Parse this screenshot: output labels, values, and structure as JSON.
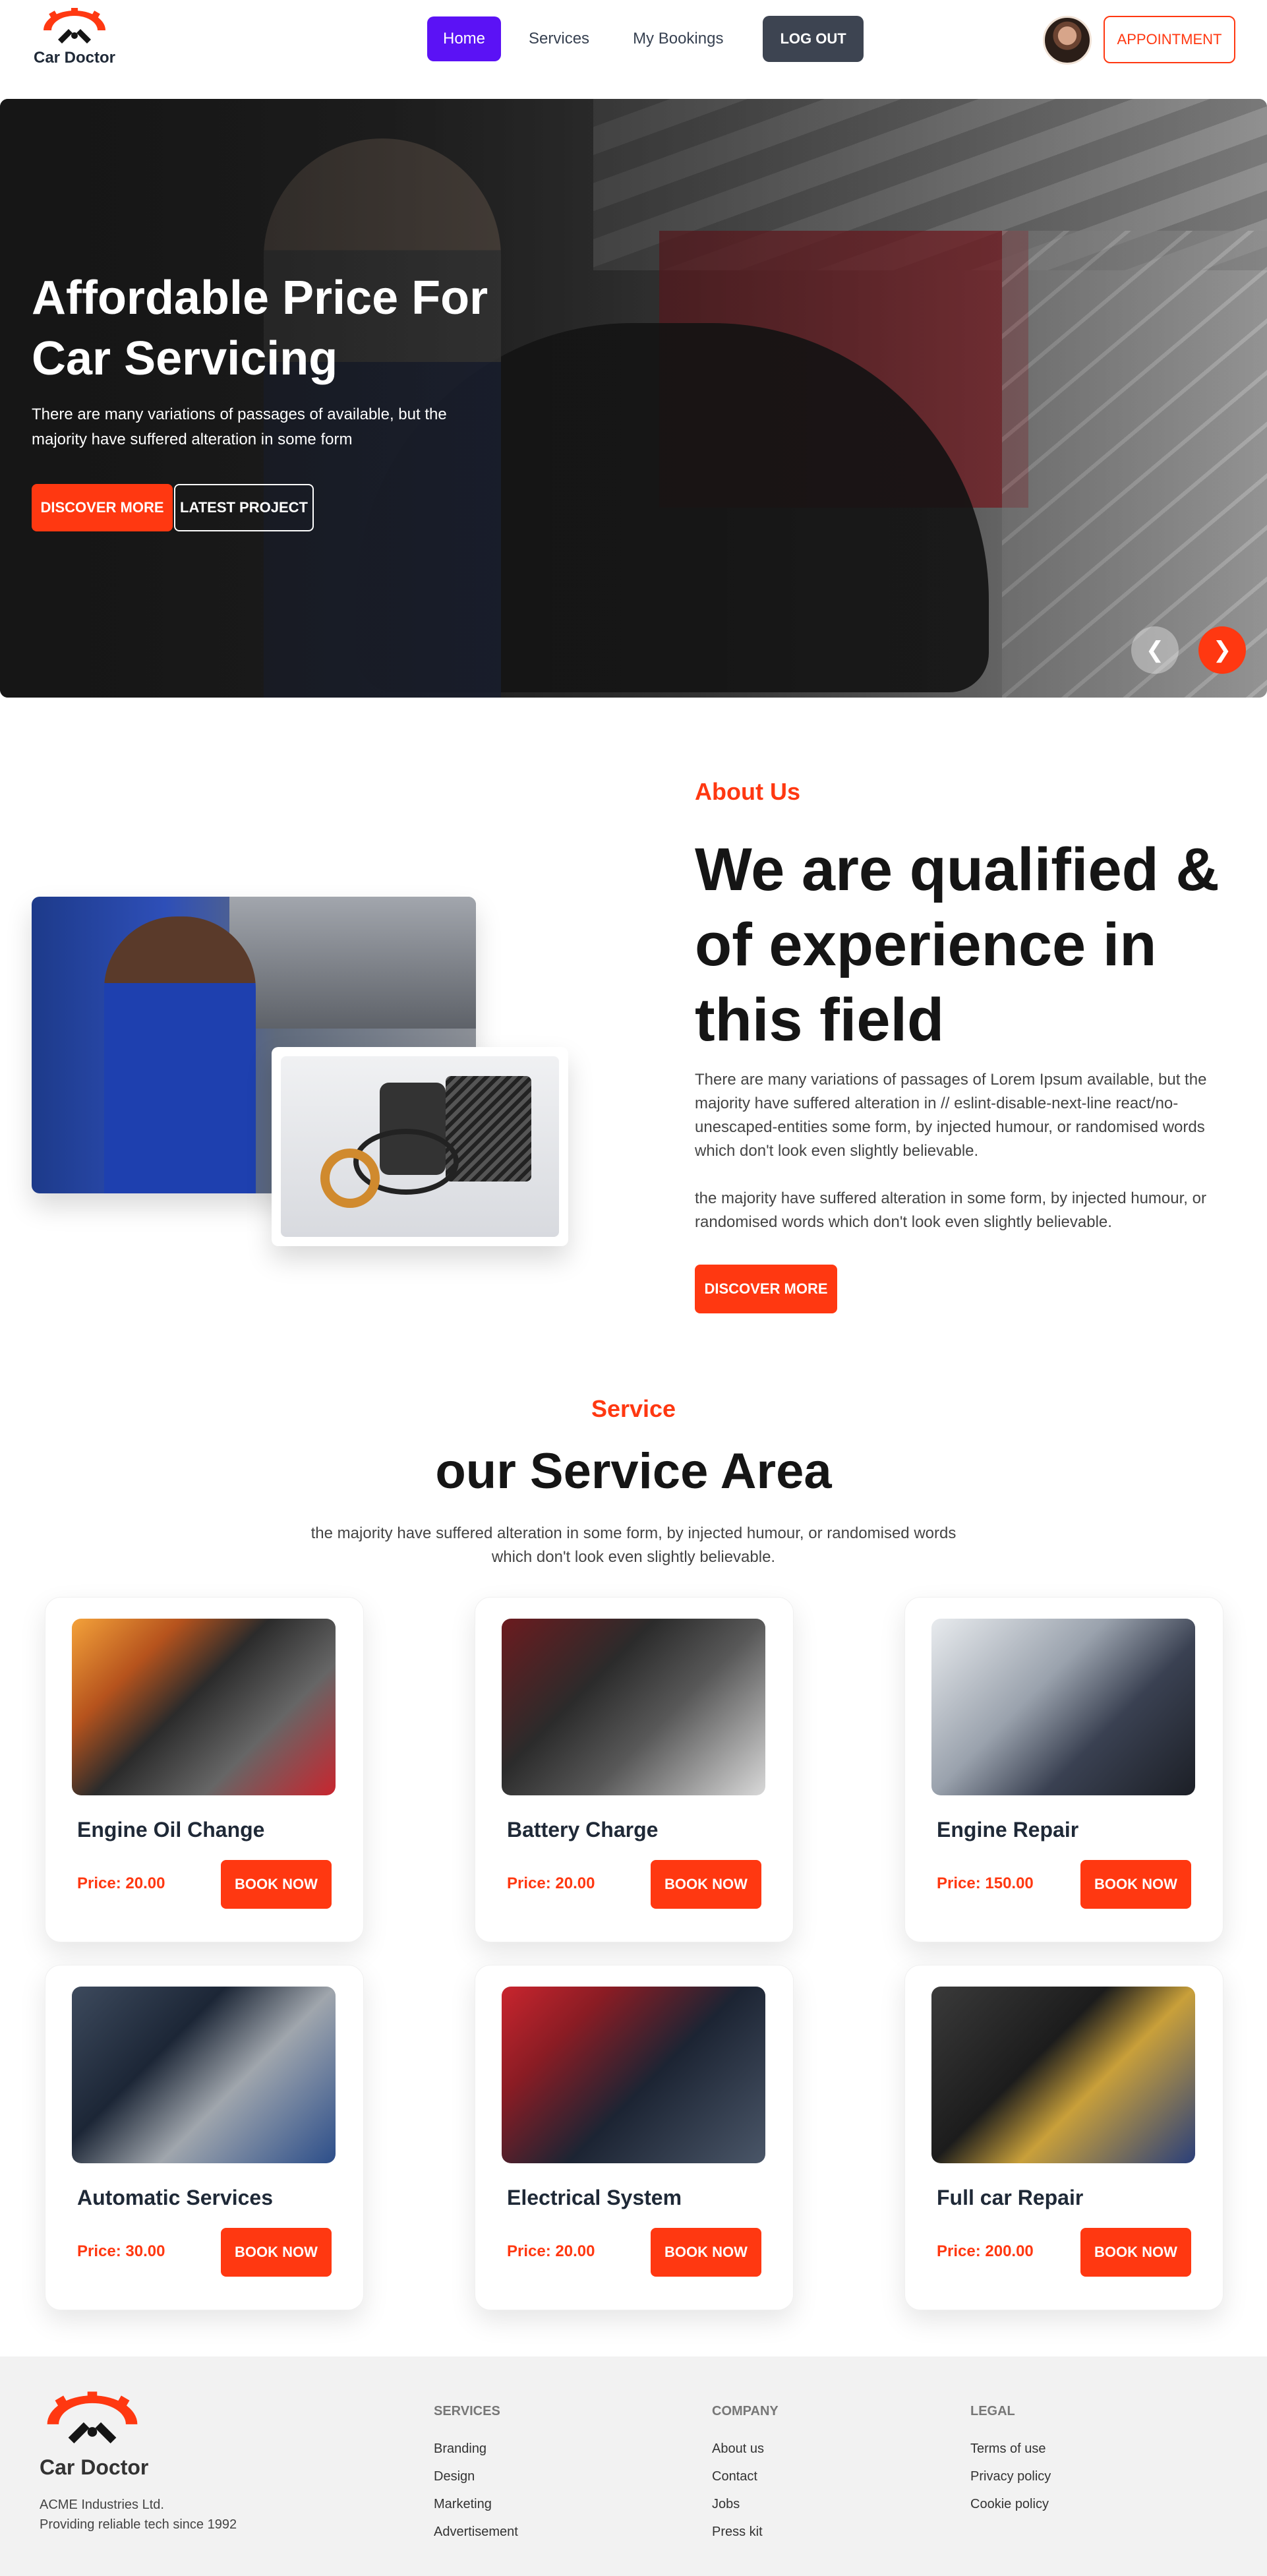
{
  "brand": {
    "name": "Car Doctor",
    "accent": "#ff3811",
    "nav_active": "#5b12f5"
  },
  "nav": {
    "links": [
      "Home",
      "Services",
      "My Bookings"
    ],
    "logout": "LOG OUT",
    "appointment": "APPOINTMENT"
  },
  "hero": {
    "title": "Affordable Price For Car Servicing",
    "text": "There are many variations of passages of available, but the majority have suffered alteration in some form",
    "primary_button": "DISCOVER MORE",
    "secondary_button": "LATEST PROJECT",
    "prev_icon": "❮",
    "next_icon": "❯"
  },
  "about": {
    "label": "About Us",
    "title": "We are qualified & of experience in this field",
    "paragraph1": "There are many variations of passages of Lorem Ipsum available, but the majority have suffered alteration in // eslint-disable-next-line react/no-unescaped-entities some form, by injected humour, or randomised words which don't look even slightly believable.",
    "paragraph2": "the majority have suffered alteration in some form, by injected humour, or randomised words which don't look even slightly believable.",
    "button": "DISCOVER MORE"
  },
  "services": {
    "label": "Service",
    "title": "our Service Area",
    "description": "the majority have suffered alteration in some form, by injected humour, or randomised words which don't look even slightly believable.",
    "book_label": "BOOK NOW",
    "items": [
      {
        "title": "Engine Oil Change",
        "price": "Price: 20.00"
      },
      {
        "title": "Battery Charge",
        "price": "Price: 20.00"
      },
      {
        "title": "Engine Repair",
        "price": "Price: 150.00"
      },
      {
        "title": "Automatic Services",
        "price": "Price: 30.00"
      },
      {
        "title": "Electrical System",
        "price": "Price: 20.00"
      },
      {
        "title": "Full car Repair",
        "price": "Price: 200.00"
      }
    ]
  },
  "footer": {
    "brand": "Car Doctor",
    "company_line1": "ACME Industries Ltd.",
    "company_line2": "Providing reliable tech since 1992",
    "columns": [
      {
        "title": "SERVICES",
        "links": [
          "Branding",
          "Design",
          "Marketing",
          "Advertisement"
        ]
      },
      {
        "title": "COMPANY",
        "links": [
          "About us",
          "Contact",
          "Jobs",
          "Press kit"
        ]
      },
      {
        "title": "LEGAL",
        "links": [
          "Terms of use",
          "Privacy policy",
          "Cookie policy"
        ]
      }
    ]
  }
}
